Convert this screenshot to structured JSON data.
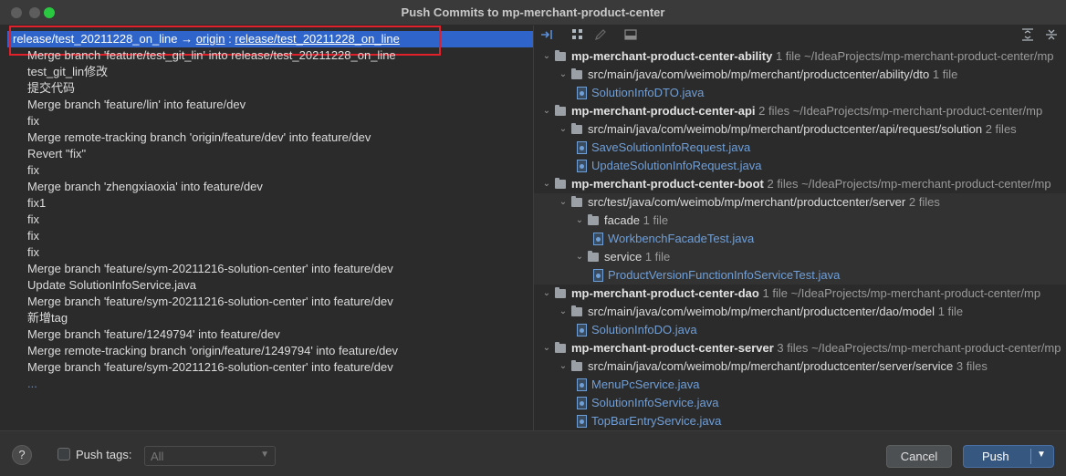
{
  "window": {
    "title": "Push Commits to mp-merchant-product-center"
  },
  "branch": {
    "local": "release/test_20211228_on_line",
    "arrow": "→",
    "remote": "origin",
    "separator": ":",
    "target": "release/test_20211228_on_line"
  },
  "commits": [
    "Merge branch 'feature/test_git_lin' into release/test_20211228_on_line",
    "test_git_lin修改",
    "提交代码",
    "Merge branch 'feature/lin' into feature/dev",
    "fix",
    "Merge remote-tracking branch 'origin/feature/dev' into feature/dev",
    "Revert \"fix\"",
    "fix",
    "Merge branch 'zhengxiaoxia' into feature/dev",
    "fix1",
    "fix",
    "fix",
    "fix",
    "Merge branch 'feature/sym-20211216-solution-center' into feature/dev",
    "Update SolutionInfoService.java",
    "Merge branch 'feature/sym-20211216-solution-center' into feature/dev",
    "新增tag",
    "Merge branch 'feature/1249794' into feature/dev",
    "Merge remote-tracking branch 'origin/feature/1249794' into feature/dev",
    "Merge branch 'feature/sym-20211216-solution-center' into feature/dev",
    "..."
  ],
  "toolbar_icons": [
    "show-diff-icon",
    "group-by-icon",
    "edit-icon",
    "tree-icon",
    "expand-all-icon",
    "collapse-all-icon"
  ],
  "tree": [
    {
      "kind": "module",
      "level": 0,
      "name": "mp-merchant-product-center-ability",
      "count": "1 file",
      "path": "~/IdeaProjects/mp-merchant-product-center/mp"
    },
    {
      "kind": "folder",
      "level": 1,
      "name": "src/main/java/com/weimob/mp/merchant/productcenter/ability/dto",
      "count": "1 file"
    },
    {
      "kind": "file",
      "level": 2,
      "name": "SolutionInfoDTO.java"
    },
    {
      "kind": "module",
      "level": 0,
      "name": "mp-merchant-product-center-api",
      "count": "2 files",
      "path": "~/IdeaProjects/mp-merchant-product-center/mp"
    },
    {
      "kind": "folder",
      "level": 1,
      "name": "src/main/java/com/weimob/mp/merchant/productcenter/api/request/solution",
      "count": "2 files"
    },
    {
      "kind": "file",
      "level": 2,
      "name": "SaveSolutionInfoRequest.java"
    },
    {
      "kind": "file",
      "level": 2,
      "name": "UpdateSolutionInfoRequest.java"
    },
    {
      "kind": "module",
      "level": 0,
      "name": "mp-merchant-product-center-boot",
      "count": "2 files",
      "path": "~/IdeaProjects/mp-merchant-product-center/mp"
    },
    {
      "kind": "folder",
      "level": 1,
      "name": "src/test/java/com/weimob/mp/merchant/productcenter/server",
      "count": "2 files",
      "hl": true
    },
    {
      "kind": "folder",
      "level": 2,
      "name": "facade",
      "count": "1 file",
      "hl": true
    },
    {
      "kind": "file",
      "level": 3,
      "name": "WorkbenchFacadeTest.java",
      "hl": true
    },
    {
      "kind": "folder",
      "level": 2,
      "name": "service",
      "count": "1 file",
      "hl": true
    },
    {
      "kind": "file",
      "level": 3,
      "name": "ProductVersionFunctionInfoServiceTest.java",
      "hl": true
    },
    {
      "kind": "module",
      "level": 0,
      "name": "mp-merchant-product-center-dao",
      "count": "1 file",
      "path": "~/IdeaProjects/mp-merchant-product-center/mp"
    },
    {
      "kind": "folder",
      "level": 1,
      "name": "src/main/java/com/weimob/mp/merchant/productcenter/dao/model",
      "count": "1 file"
    },
    {
      "kind": "file",
      "level": 2,
      "name": "SolutionInfoDO.java"
    },
    {
      "kind": "module",
      "level": 0,
      "name": "mp-merchant-product-center-server",
      "count": "3 files",
      "path": "~/IdeaProjects/mp-merchant-product-center/mp"
    },
    {
      "kind": "folder",
      "level": 1,
      "name": "src/main/java/com/weimob/mp/merchant/productcenter/server/service",
      "count": "3 files"
    },
    {
      "kind": "file",
      "level": 2,
      "name": "MenuPcService.java"
    },
    {
      "kind": "file",
      "level": 2,
      "name": "SolutionInfoService.java"
    },
    {
      "kind": "file",
      "level": 2,
      "name": "TopBarEntryService.java"
    }
  ],
  "footer": {
    "help": "?",
    "push_tags_label": "Push tags:",
    "push_tags_value": "All",
    "cancel_label": "Cancel",
    "push_label": "Push"
  },
  "colors": {
    "selection": "#2f65ca",
    "link": "#6f9fd8",
    "highlight_box": "#e0202a",
    "push_button": "#365880"
  }
}
